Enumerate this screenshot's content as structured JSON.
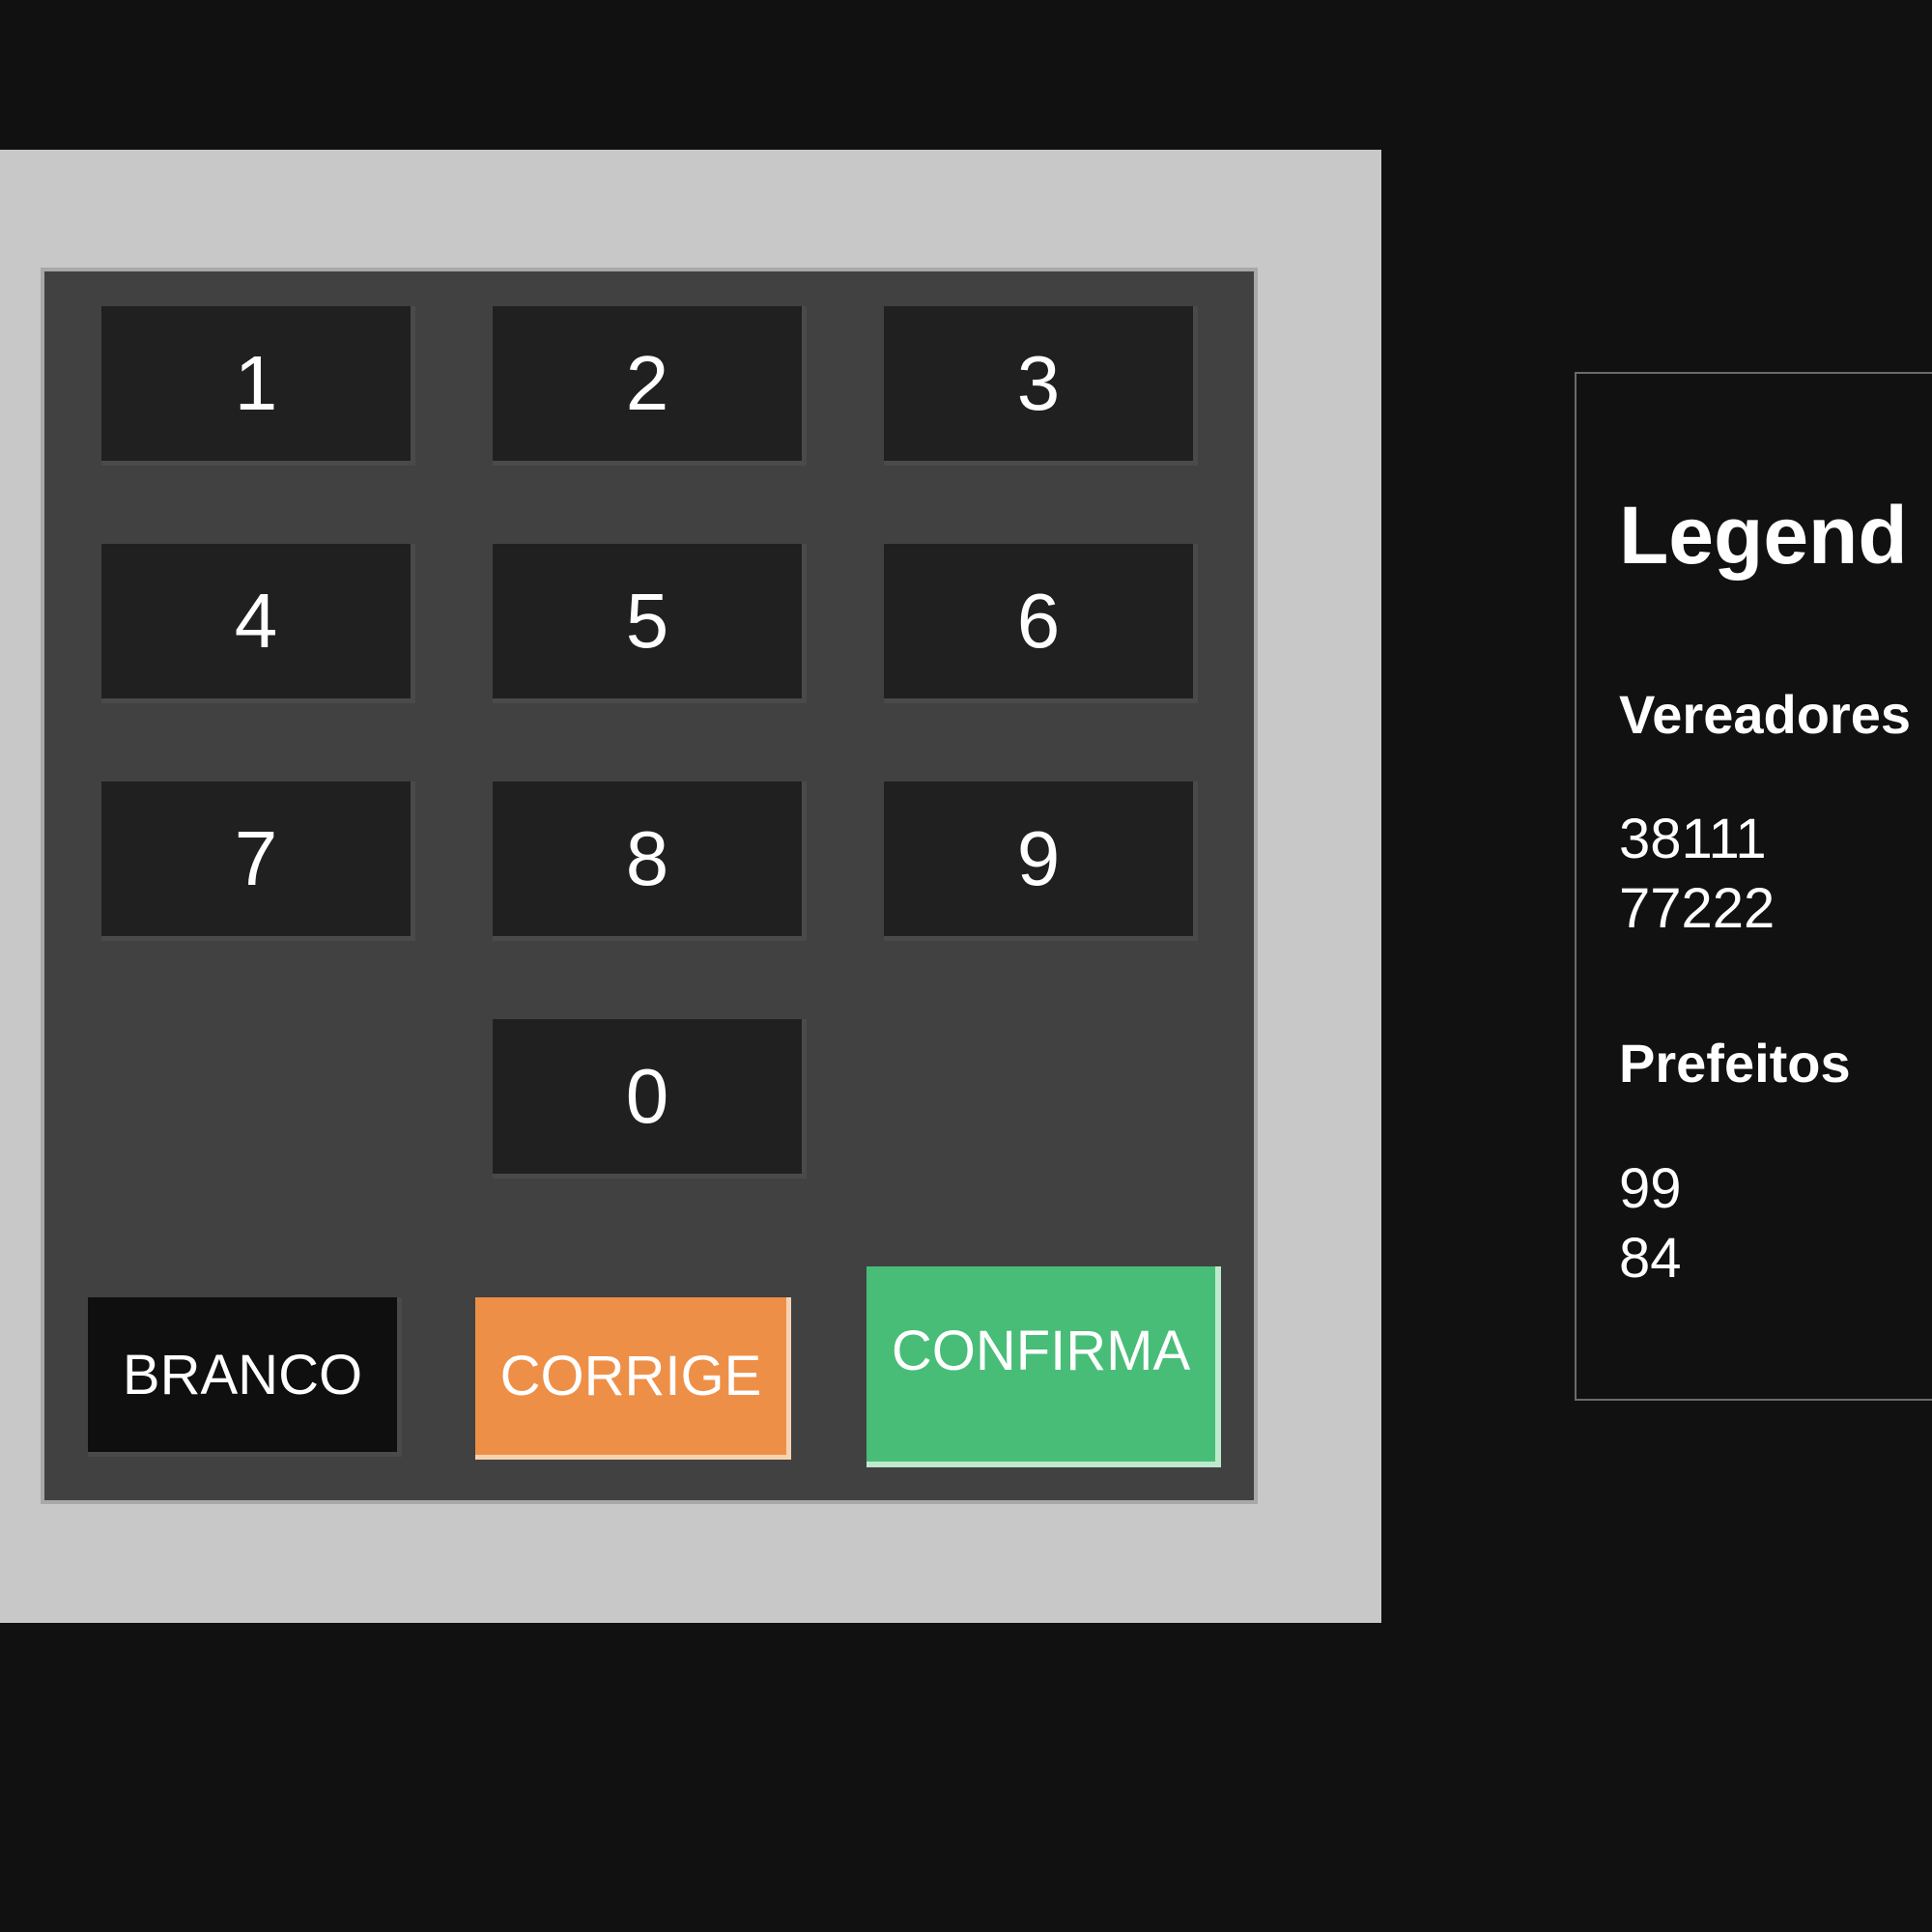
{
  "keypad": {
    "keys": [
      "1",
      "2",
      "3",
      "4",
      "5",
      "6",
      "7",
      "8",
      "9",
      "0"
    ]
  },
  "actions": {
    "branco_label": "BRANCO",
    "corrige_label": "CORRIGE",
    "confirma_label": "CONFIRMA"
  },
  "colors": {
    "background": "#111111",
    "urna_body": "#c8c8c8",
    "keypad": "#414141",
    "key": "#202020",
    "branco": "#0f0f0f",
    "corrige": "#ee8f48",
    "confirma": "#48bd77"
  },
  "legend": {
    "title": "Legend",
    "vereadores": {
      "title": "Vereadores",
      "items": [
        "38111",
        "77222"
      ]
    },
    "prefeitos": {
      "title": "Prefeitos",
      "items": [
        "99",
        "84"
      ]
    }
  }
}
